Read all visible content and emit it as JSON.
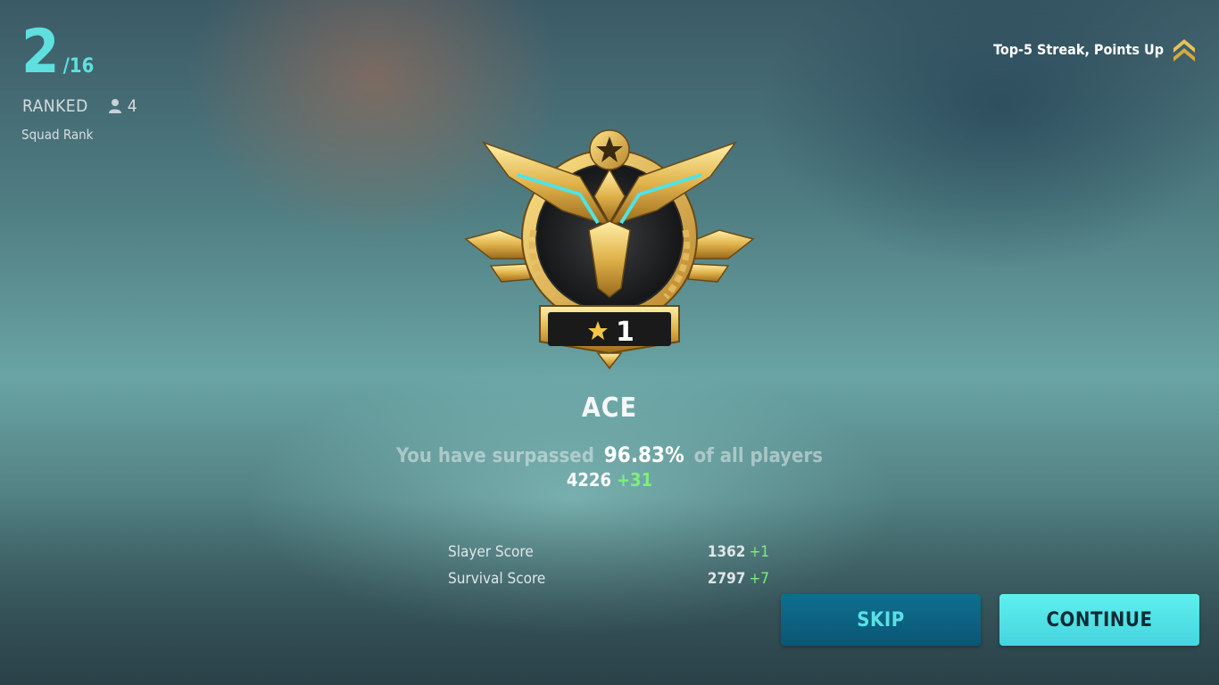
{
  "ranking": {
    "position": "2",
    "total": "/16",
    "mode": "RANKED",
    "squad_size": "4",
    "label": "Squad Rank"
  },
  "streak": {
    "text": "Top-5 Streak, Points Up",
    "icon": "double-chevron-up-icon"
  },
  "badge": {
    "tier": "ACE",
    "stars": "1",
    "icon": "ace-tier-emblem"
  },
  "summary": {
    "surpass_prefix": "You have surpassed",
    "surpass_pct": "96.83%",
    "surpass_suffix": "of all players",
    "total_points": "4226",
    "points_delta": "+31"
  },
  "scores": [
    {
      "label": "Slayer Score",
      "value": "1362",
      "delta": "+1"
    },
    {
      "label": "Survival Score",
      "value": "2797",
      "delta": "+7"
    }
  ],
  "buttons": {
    "skip": "SKIP",
    "continue": "CONTINUE"
  },
  "colors": {
    "accent": "#5fe0df",
    "positive": "#7df07a",
    "skip_bg": "#0a5674",
    "continue_bg": "#4fe0e6"
  }
}
